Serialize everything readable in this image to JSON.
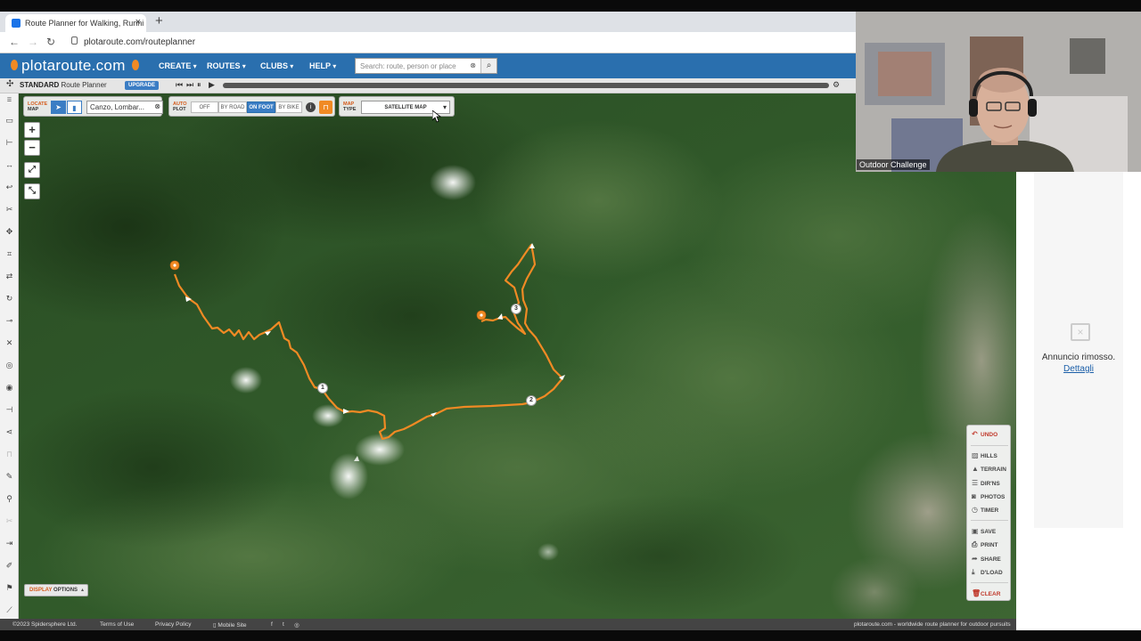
{
  "browser": {
    "tab_title": "Route Planner for Walking, Runni",
    "url": "plotaroute.com/routeplanner"
  },
  "site": {
    "logo": "plotaroute.com",
    "menu": [
      "CREATE",
      "ROUTES",
      "CLUBS",
      "HELP"
    ],
    "search_placeholder": "Search: route, person or place"
  },
  "planner": {
    "mode_prefix": "STANDARD",
    "mode_label": "Route Planner",
    "upgrade_label": "UPGRADE"
  },
  "controls": {
    "locate_label_1": "LOCATE",
    "locate_label_2": "MAP",
    "location_value": "Canzo, Lombar...",
    "autoplot_label_1": "AUTO",
    "autoplot_label_2": "PLOT",
    "autoplot_options": [
      "OFF",
      "BY ROAD",
      "ON FOOT",
      "BY BIKE"
    ],
    "autoplot_selected": "ON FOOT",
    "maptype_label_1": "MAP",
    "maptype_label_2": "TYPE",
    "maptype_value": "SATELLITE MAP"
  },
  "route": {
    "markers": [
      "1",
      "2",
      "3"
    ],
    "route_color": "#f08a24"
  },
  "right_tools": {
    "undo": "UNDO",
    "items": [
      "HILLS",
      "TERRAIN",
      "DIR'NS",
      "PHOTOS",
      "TIMER"
    ],
    "items2": [
      "SAVE",
      "PRINT",
      "SHARE",
      "D'LOAD"
    ],
    "clear": "CLEAR"
  },
  "display_options": {
    "prefix": "DISPLAY",
    "label": "OPTIONS"
  },
  "footer": {
    "copyright": "©2023 Spidersphere Ltd.",
    "terms": "Terms of Use",
    "privacy": "Privacy Policy",
    "mobile": "Mobile Site",
    "tagline": "plotaroute.com - worldwide route planner for outdoor pursuits"
  },
  "ad": {
    "removed_text": "Annuncio rimosso.",
    "details_link": "Dettagli"
  },
  "webcam": {
    "label": "Outdoor Challenge"
  }
}
